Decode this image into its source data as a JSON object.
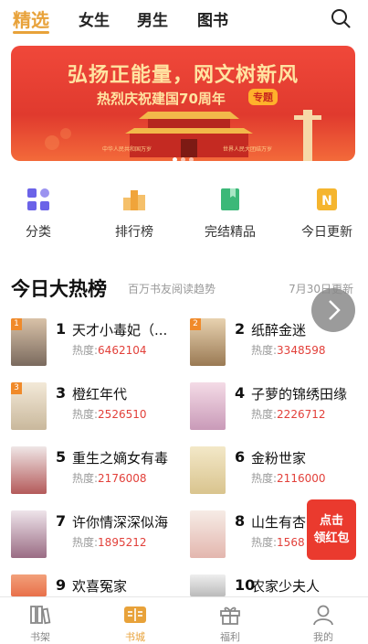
{
  "tabs": [
    "精选",
    "女生",
    "男生",
    "图书"
  ],
  "banner": {
    "headline": "弘扬正能量，网文树新风",
    "subline": "热烈庆祝建国70周年",
    "tag": "专题",
    "footnote_left": "中华人民共和国万岁",
    "footnote_right": "世界人民大团结万岁"
  },
  "categories": [
    {
      "label": "分类",
      "icon": "grid-icon",
      "color": "#6b63e8"
    },
    {
      "label": "排行榜",
      "icon": "podium-icon",
      "color": "#f0a43a"
    },
    {
      "label": "完结精品",
      "icon": "bookmark-book-icon",
      "color": "#3cb878"
    },
    {
      "label": "今日更新",
      "icon": "n-badge-icon",
      "color": "#f5b52e"
    }
  ],
  "hot": {
    "title": "今日大热榜",
    "subtitle": "百万书友阅读趋势",
    "date": "7月30日更新",
    "heat_prefix": "热度:",
    "books": [
      {
        "rank": "1",
        "name": "天才小毒妃（...",
        "heat": "6462104"
      },
      {
        "rank": "2",
        "name": "纸醉金迷",
        "heat": "3348598"
      },
      {
        "rank": "3",
        "name": "橙红年代",
        "heat": "2526510"
      },
      {
        "rank": "4",
        "name": "子萝的锦绣田缘",
        "heat": "2226712"
      },
      {
        "rank": "5",
        "name": "重生之嫡女有毒",
        "heat": "2176008"
      },
      {
        "rank": "6",
        "name": "金粉世家",
        "heat": "2116000"
      },
      {
        "rank": "7",
        "name": "许你情深深似海",
        "heat": "1895212"
      },
      {
        "rank": "8",
        "name": "山生有杏",
        "heat": "1568"
      },
      {
        "rank": "9",
        "name": "欢喜冤家",
        "heat": ""
      },
      {
        "rank": "10",
        "name": "农家少夫人",
        "heat": ""
      }
    ]
  },
  "red_packet": {
    "line1": "点击",
    "line2": "领红包"
  },
  "bottom_nav": [
    {
      "label": "书架",
      "icon": "bookshelf-icon"
    },
    {
      "label": "书城",
      "icon": "bookstore-icon"
    },
    {
      "label": "福利",
      "icon": "gift-icon"
    },
    {
      "label": "我的",
      "icon": "user-icon"
    }
  ],
  "colors": {
    "accent": "#e8a23a",
    "heat": "#e2403a",
    "banner": "#e03a2e"
  }
}
